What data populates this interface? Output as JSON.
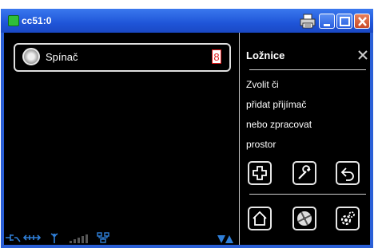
{
  "window": {
    "title": "cc51:0"
  },
  "left": {
    "device": {
      "label": "Spínač",
      "badge": "8",
      "icon": "round-switch-icon"
    }
  },
  "status": {
    "icons": [
      "power-plug-icon",
      "link-arrows-icon",
      "antenna-icon",
      "signal-bars-icon",
      "network-icon",
      "scroll-arrows-icon"
    ]
  },
  "right": {
    "title": "Ložnice",
    "lines": [
      "Zvolit či",
      "přidat přijímač",
      "nebo zpracovat",
      "prostor"
    ],
    "actions": [
      "add-icon",
      "wrench-icon",
      "back-icon"
    ],
    "nav": [
      "home-icon",
      "fan-icon",
      "settings-icon"
    ]
  },
  "colors": {
    "accent": "#2a5fd6",
    "status_icons": "#2f7fd8",
    "badge": "#e01818"
  }
}
